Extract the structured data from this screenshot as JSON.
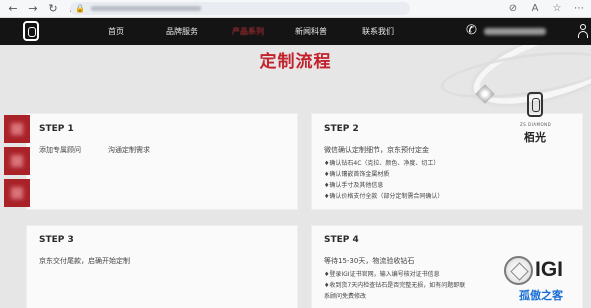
{
  "browser": {
    "back_icon": "back-arrow-icon",
    "forward_icon": "forward-arrow-icon",
    "reload_icon": "reload-icon"
  },
  "nav": {
    "items": [
      "首页",
      "品牌服务",
      "产品系列",
      "新闻科普",
      "联系我们"
    ],
    "active_index": 2
  },
  "title": "定制流程",
  "steps": [
    {
      "label": "STEP 1",
      "lines": [
        "添加专属顾问",
        "沟通定制需求"
      ],
      "bullets": []
    },
    {
      "label": "STEP 2",
      "lines": [
        "微信确认定制细节，京东预付定金"
      ],
      "bullets": [
        "♦确认钻石4C（克拉、颜色、净度、切工）",
        "♦确认镶嵌首饰金属材质",
        "♦确认手寸及其他信息",
        "♦确认价格支付全款（部分定制需合同确认）"
      ]
    },
    {
      "label": "STEP 3",
      "lines": [
        "京东交付尾款，启确开始定制"
      ],
      "bullets": []
    },
    {
      "label": "STEP 4",
      "lines": [
        "等待15-30天，物流验收钻石"
      ],
      "bullets": [
        "♦登录IGI证书官网，输入编号核对证书信息",
        "♦收到货7天内检查钻石是否完整无损，如有问题即联",
        "系顾问免费修改"
      ]
    }
  ],
  "brand": {
    "sub": "ZS DIAMOND",
    "name": "栢光"
  },
  "igi": "IGI",
  "watermark": "孤傲之客",
  "colors": {
    "accent": "#c3232d",
    "nav_bg": "#141414",
    "side_tab": "#a82228"
  }
}
